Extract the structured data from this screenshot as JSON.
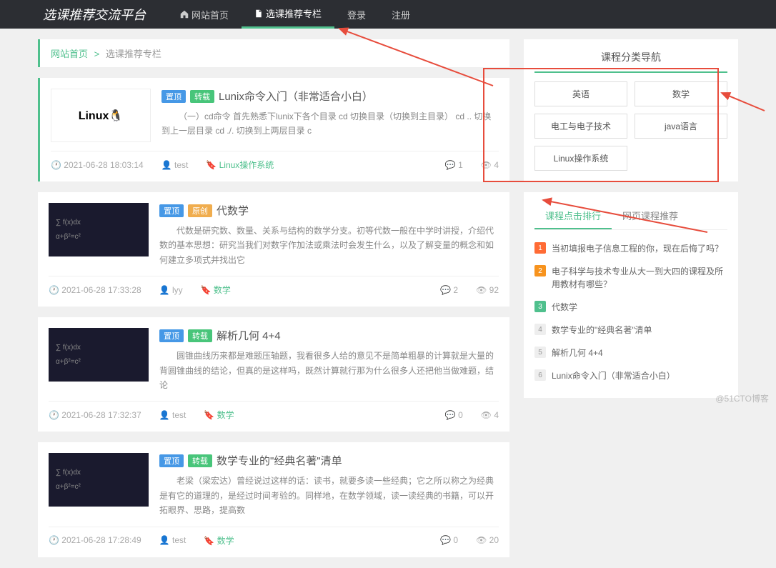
{
  "brand": "选课推荐交流平台",
  "nav": [
    {
      "label": "网站首页",
      "icon": "home"
    },
    {
      "label": "选课推荐专栏",
      "icon": "file",
      "active": true
    },
    {
      "label": "登录",
      "icon": ""
    },
    {
      "label": "注册",
      "icon": ""
    }
  ],
  "breadcrumb": {
    "home": "网站首页",
    "sep": ">",
    "current": "选课推荐专栏"
  },
  "articles": [
    {
      "tags": [
        "置顶",
        "转载"
      ],
      "title": "Lunix命令入门（非常适合小白）",
      "excerpt": "（一）cd命令 首先熟悉下lunix下各个目录 cd 切换目录（切换到主目录） cd .. 切换到上一层目录 cd ./. 切换到上两层目录 c",
      "time": "2021-06-28 18:03:14",
      "author": "test",
      "category": "Linux操作系统",
      "comments": "1",
      "views": "4",
      "thumb": "linux"
    },
    {
      "tags": [
        "置顶",
        "原创"
      ],
      "title": "代数学",
      "excerpt": "代数是研究数、数量、关系与结构的数学分支。初等代数一般在中学时讲授，介绍代数的基本思想：研究当我们对数字作加法或乘法时会发生什么，以及了解变量的概念和如何建立多项式并找出它",
      "time": "2021-06-28 17:33:28",
      "author": "lyy",
      "category": "数学",
      "comments": "2",
      "views": "92",
      "thumb": "math"
    },
    {
      "tags": [
        "置顶",
        "转载"
      ],
      "title": "解析几何 4+4",
      "excerpt": "圆锥曲线历来都是难题压轴题，我看很多人给的意见不是简单粗暴的计算就是大量的背圆锥曲线的结论，但真的是这样吗，既然计算就行那为什么很多人还把他当做难题，结论",
      "time": "2021-06-28 17:32:37",
      "author": "test",
      "category": "数学",
      "comments": "0",
      "views": "4",
      "thumb": "math"
    },
    {
      "tags": [
        "置顶",
        "转载"
      ],
      "title": "数学专业的\"经典名著\"清单",
      "excerpt": "老梁（梁宏达）曾经说过这样的话：读书，就要多读一些经典；它之所以称之为经典是有它的道理的，是经过时间考验的。同样地，在数学领域，读一读经典的书籍，可以开拓眼界、思路，提高数",
      "time": "2021-06-28 17:28:49",
      "author": "test",
      "category": "数学",
      "comments": "0",
      "views": "20",
      "thumb": "math"
    }
  ],
  "category_nav": {
    "title": "课程分类导航",
    "items": [
      "英语",
      "数学",
      "电工与电子技术",
      "java语言",
      "Linux操作系统"
    ]
  },
  "rank_tabs": [
    "课程点击排行",
    "网页课程推荐"
  ],
  "rank_list": [
    "当初填报电子信息工程的你，现在后悔了吗？",
    "电子科学与技术专业从大一到大四的课程及所用教材有哪些？",
    "代数学",
    "数学专业的\"经典名著\"清单",
    "解析几何 4+4",
    "Lunix命令入门（非常适合小白）"
  ],
  "watermark": "@51CTO博客"
}
